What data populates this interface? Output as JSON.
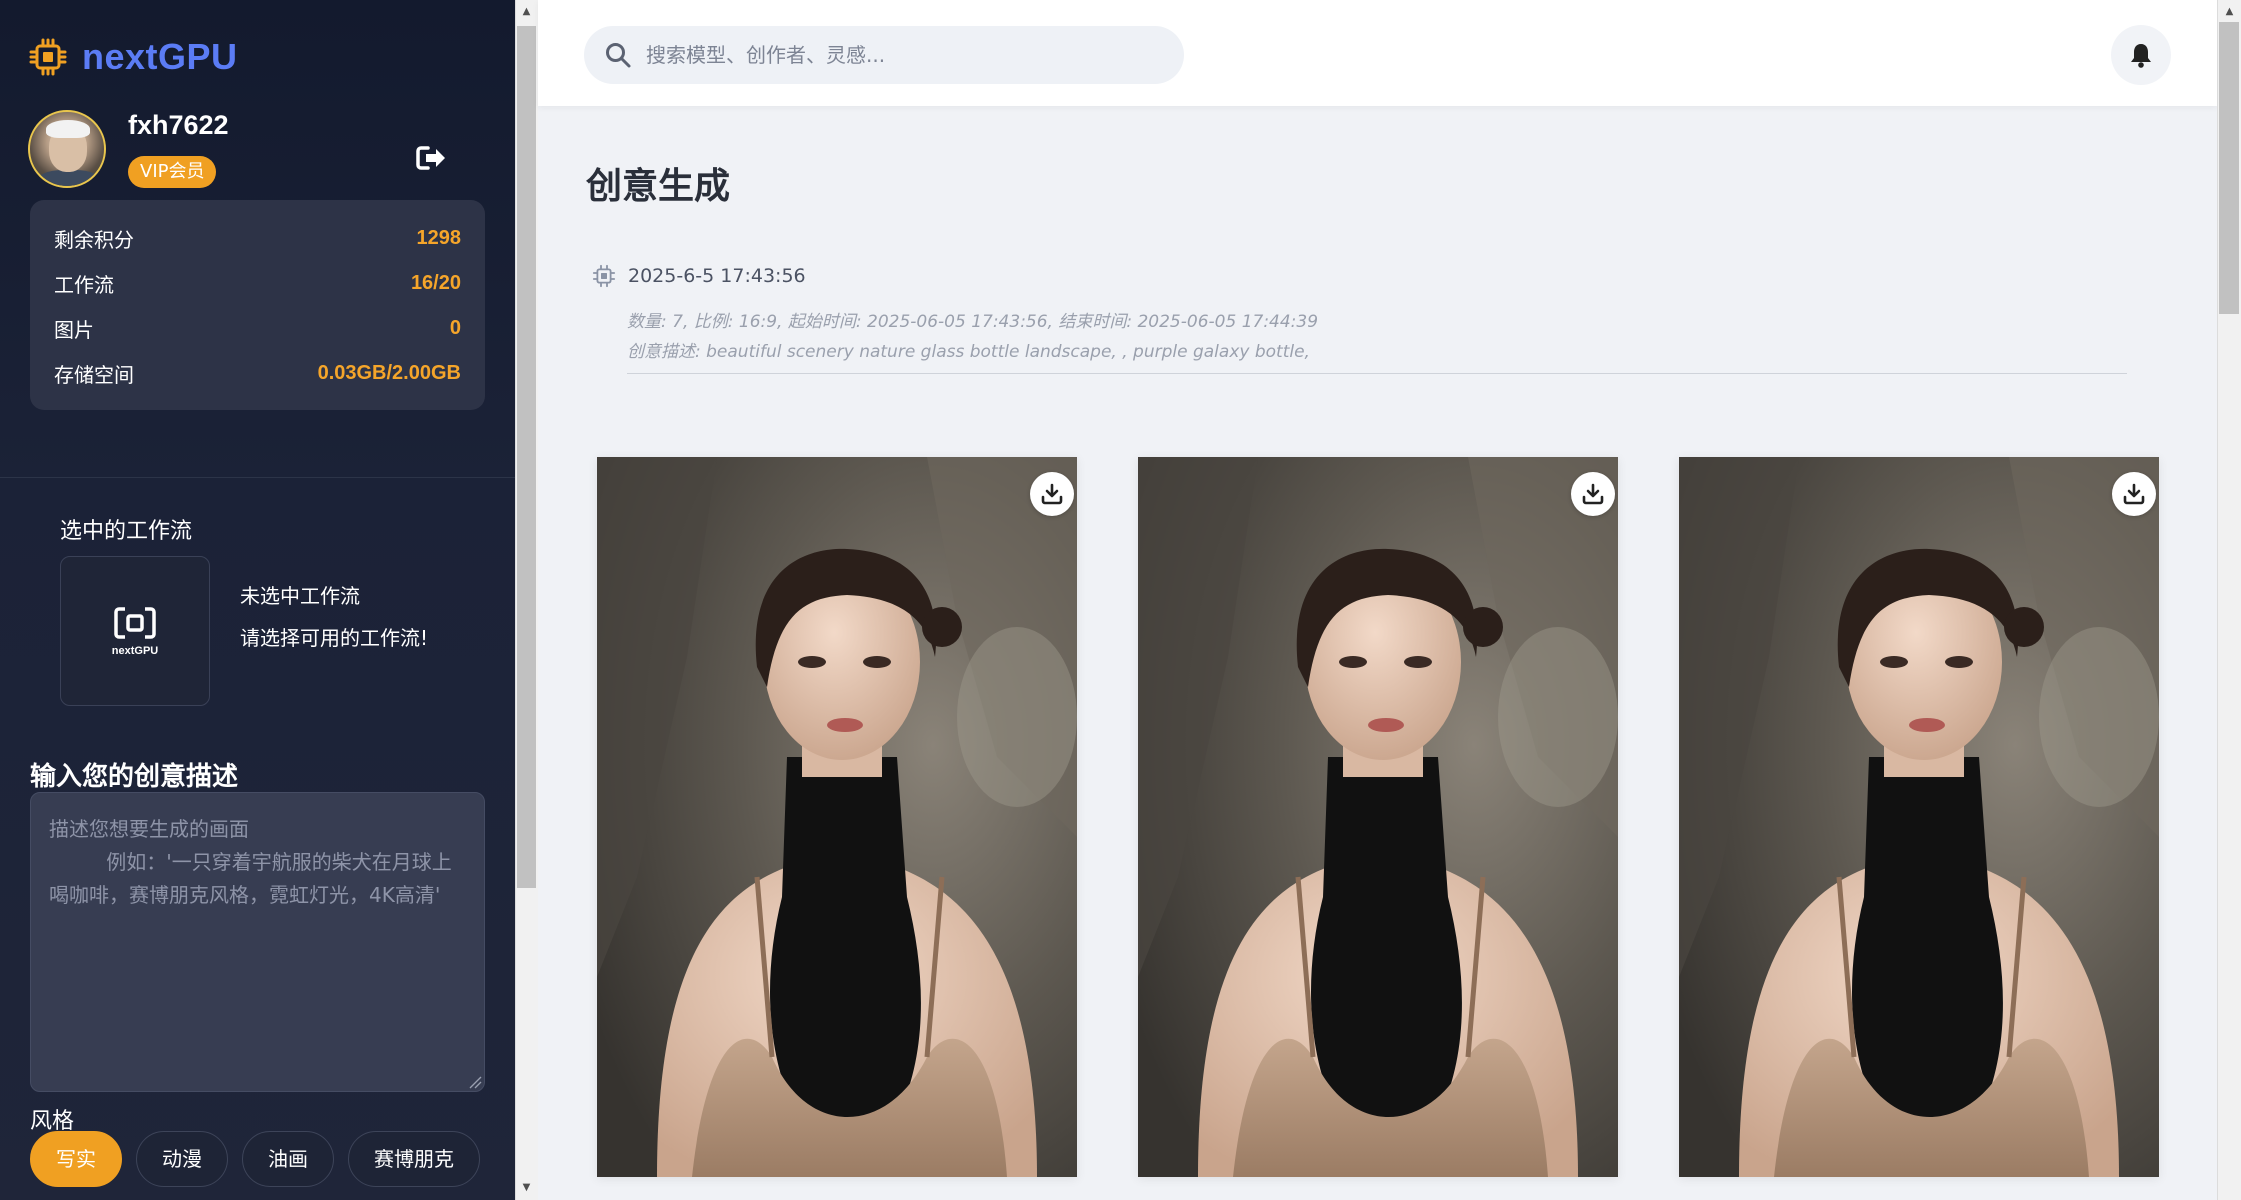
{
  "brand": {
    "name": "nextGPU",
    "icon": "chip-icon",
    "accent": "#5b7cf5"
  },
  "user": {
    "name": "fxh7622",
    "badge": "VIP会员"
  },
  "stats": [
    {
      "label": "剩余积分",
      "value": "1298"
    },
    {
      "label": "工作流",
      "value": "16/20"
    },
    {
      "label": "图片",
      "value": "0"
    },
    {
      "label": "存储空间",
      "value": "0.03GB/2.00GB"
    }
  ],
  "workflow": {
    "heading": "选中的工作流",
    "logo_text": "nextGPU",
    "none_text": "未选中工作流",
    "hint_text": "请选择可用的工作流!"
  },
  "prompt": {
    "title": "输入您的创意描述",
    "placeholder": "描述您想要生成的画面\n         例如：'一只穿着宇航服的柴犬在月球上喝咖啡，赛博朋克风格，霓虹灯光，4K高清'"
  },
  "styles": {
    "title": "风格",
    "options": [
      "写实",
      "动漫",
      "油画",
      "赛博朋克"
    ],
    "selected": "写实"
  },
  "search": {
    "placeholder": "搜索模型、创作者、灵感..."
  },
  "main": {
    "title": "创意生成"
  },
  "task": {
    "time": "2025-6-5 17:43:56",
    "meta": "数量: 7, 比例: 16:9, 起始时间: 2025-06-05 17:43:56, 结束时间: 2025-06-05 17:44:39",
    "desc": "创意描述: beautiful scenery nature glass bottle landscape, , purple galaxy bottle,"
  },
  "colors": {
    "accent_orange": "#f0a022",
    "sidebar_bg": "#1b2237"
  }
}
